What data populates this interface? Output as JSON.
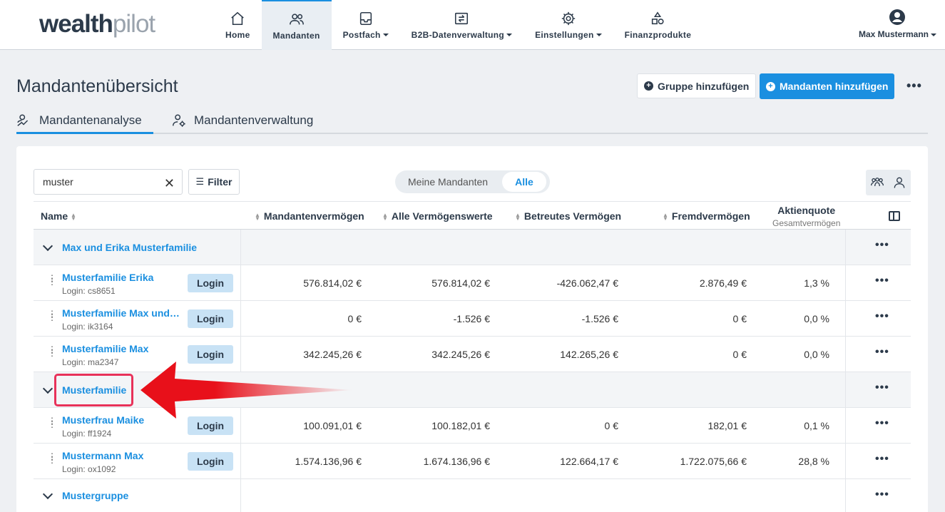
{
  "brand": {
    "part1": "wealth",
    "part2": "pilot"
  },
  "nav": [
    {
      "label": "Home",
      "icon": "home-icon",
      "dropdown": false,
      "active": false
    },
    {
      "label": "Mandanten",
      "icon": "users-icon",
      "dropdown": false,
      "active": true
    },
    {
      "label": "Postfach",
      "icon": "inbox-icon",
      "dropdown": true,
      "active": false
    },
    {
      "label": "B2B-Datenverwaltung",
      "icon": "data-transfer-icon",
      "dropdown": true,
      "active": false
    },
    {
      "label": "Einstellungen",
      "icon": "gear-icon",
      "dropdown": true,
      "active": false
    },
    {
      "label": "Finanzprodukte",
      "icon": "shapes-icon",
      "dropdown": false,
      "active": false
    }
  ],
  "user": {
    "name": "Max Mustermann"
  },
  "page": {
    "title": "Mandantenübersicht",
    "add_group": "Gruppe hinzufügen",
    "add_client": "Mandanten hinzufügen",
    "more": "•••"
  },
  "tabs": [
    {
      "label": "Mandantenanalyse",
      "active": true
    },
    {
      "label": "Mandantenverwaltung",
      "active": false
    }
  ],
  "toolbar": {
    "search_value": "muster",
    "filter_label": "Filter",
    "toggle": [
      "Meine Mandanten",
      "Alle"
    ],
    "toggle_selected": "Alle"
  },
  "table": {
    "headers": {
      "name": "Name",
      "mandantenvermoegen": "Mandantenvermögen",
      "alle": "Alle Vermögenswerte",
      "betreut": "Betreutes Vermögen",
      "fremd": "Fremdvermögen",
      "aktien": "Aktienquote",
      "aktien_sub": "Gesamtvermögen"
    },
    "login_label": "Login",
    "more_label": "•••",
    "rows": [
      {
        "type": "group",
        "name": "Max und Erika Musterfamilie"
      },
      {
        "type": "person",
        "name": "Musterfamilie Erika",
        "login": "Login: cs8651",
        "mv": "576.814,02 €",
        "av": "576.814,02 €",
        "bv": "-426.062,47 €",
        "fv": "2.876,49 €",
        "aq": "1,3 %"
      },
      {
        "type": "person",
        "name": "Musterfamilie Max und ...",
        "login": "Login: ik3164",
        "mv": "0 €",
        "av": "-1.526 €",
        "bv": "-1.526 €",
        "fv": "0 €",
        "aq": "0,0 %"
      },
      {
        "type": "person",
        "name": "Musterfamilie Max",
        "login": "Login: ma2347",
        "mv": "342.245,26 €",
        "av": "342.245,26 €",
        "bv": "142.265,26 €",
        "fv": "0 €",
        "aq": "0,0 %"
      },
      {
        "type": "group",
        "name": "Musterfamilie"
      },
      {
        "type": "person",
        "name": "Musterfrau Maike",
        "login": "Login: ff1924",
        "mv": "100.091,01 €",
        "av": "100.182,01 €",
        "bv": "0 €",
        "fv": "182,01 €",
        "aq": "0,1 %"
      },
      {
        "type": "person",
        "name": "Mustermann Max",
        "login": "Login: ox1092",
        "mv": "1.574.136,96 €",
        "av": "1.674.136,96 €",
        "bv": "122.664,17 €",
        "fv": "1.722.075,66 €",
        "aq": "28,8 %"
      },
      {
        "type": "group",
        "name": "Mustergruppe"
      }
    ]
  },
  "colors": {
    "accent": "#1a8fe0",
    "highlight": "#e8325a",
    "arrow": "#e8101a"
  }
}
